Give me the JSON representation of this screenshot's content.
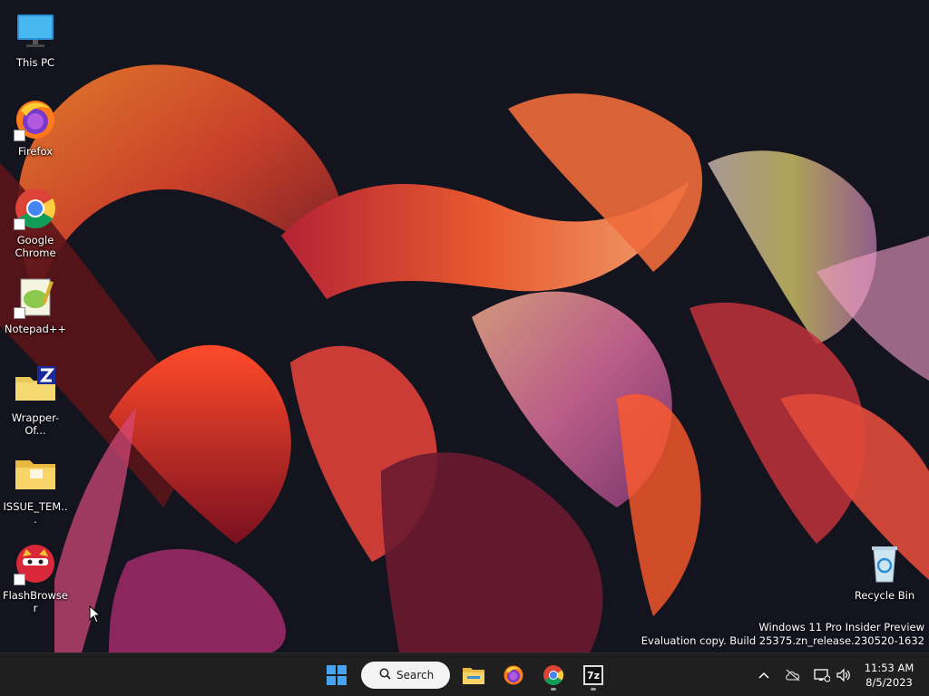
{
  "desktop": {
    "icons": [
      {
        "label": "This PC"
      },
      {
        "label": "Firefox"
      },
      {
        "label": "Google Chrome"
      },
      {
        "label": "Notepad++"
      },
      {
        "label": "Wrapper-Of..."
      },
      {
        "label": "ISSUE_TEM..."
      },
      {
        "label": "FlashBrowser"
      }
    ],
    "recycle_bin": {
      "label": "Recycle Bin"
    }
  },
  "watermark": {
    "line1": "Windows 11 Pro Insider Preview",
    "line2": "Evaluation copy. Build 25375.zn_release.230520-1632"
  },
  "taskbar": {
    "search_label": "Search",
    "apps": [
      "start-icon",
      "file-explorer-icon",
      "firefox-icon",
      "chrome-icon",
      "7zip-icon"
    ],
    "sevenzip_glyph": "7z",
    "clock": {
      "time": "11:53 AM",
      "date": "8/5/2023"
    }
  },
  "colors": {
    "taskbar_bg": "#1f1f1f",
    "desktop_bg": "#12121c",
    "start_blue": "#4aa3f0"
  }
}
